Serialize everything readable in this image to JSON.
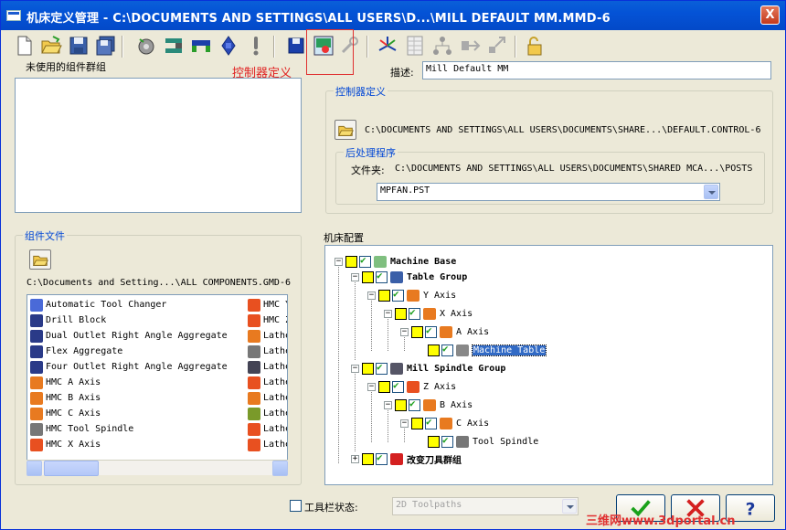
{
  "window": {
    "title": "机床定义管理 - C:\\DOCUMENTS AND SETTINGS\\ALL USERS\\D...\\MILL DEFAULT MM.MMD-6",
    "close_glyph": "X"
  },
  "toolbar": {
    "tooltip": "控制器定义",
    "icons": [
      "new-file-icon",
      "open-folder-icon",
      "save-icon",
      "save-as-icon",
      "tool-change-icon",
      "machine-component-icon",
      "clamp-icon",
      "spindle-icon",
      "warning-icon",
      "disk-icon",
      "control-definition-icon",
      "wrench-icon",
      "axis-icon",
      "grid-table-icon",
      "tree-structure-icon",
      "move-arrow-icon",
      "diagonal-arrow-icon",
      "lock-icon"
    ]
  },
  "unused_groups": {
    "label": "未使用的组件群组"
  },
  "description": {
    "label": "描述:",
    "value": "Mill Default MM"
  },
  "control_definition": {
    "title": "控制器定义",
    "path": "C:\\DOCUMENTS AND SETTINGS\\ALL USERS\\DOCUMENTS\\SHARE...\\DEFAULT.CONTROL-6"
  },
  "post_processor": {
    "title": "后处理程序",
    "folder_label": "文件夹:",
    "folder_path": "C:\\DOCUMENTS AND SETTINGS\\ALL USERS\\DOCUMENTS\\SHARED MCA...\\POSTS",
    "selected": "MPFAN.PST"
  },
  "component_files": {
    "title": "组件文件",
    "path": "C:\\Documents and Setting...\\ALL COMPONENTS.GMD-6",
    "left_items": [
      {
        "label": "Automatic Tool Changer",
        "icon": "tool-changer-icon"
      },
      {
        "label": "Drill Block",
        "icon": "drill-block-icon"
      },
      {
        "label": "Dual Outlet Right Angle Aggregate",
        "icon": "aggregate-icon"
      },
      {
        "label": "Flex Aggregate",
        "icon": "aggregate-icon"
      },
      {
        "label": "Four Outlet Right Angle Aggregate",
        "icon": "aggregate-icon"
      },
      {
        "label": "HMC A Axis",
        "icon": "axis-component-icon"
      },
      {
        "label": "HMC B Axis",
        "icon": "axis-component-icon"
      },
      {
        "label": "HMC C Axis",
        "icon": "axis-component-icon"
      },
      {
        "label": "HMC Tool Spindle",
        "icon": "spindle-icon"
      },
      {
        "label": "HMC X Axis",
        "icon": "linear-axis-icon"
      }
    ],
    "right_items": [
      {
        "label": "HMC Y",
        "icon": "linear-axis-icon"
      },
      {
        "label": "HMC Z",
        "icon": "linear-axis-icon"
      },
      {
        "label": "Lathe",
        "icon": "axis-component-icon"
      },
      {
        "label": "Lathe",
        "icon": "spindle-icon"
      },
      {
        "label": "Lathe",
        "icon": "turret-icon"
      },
      {
        "label": "Lathe",
        "icon": "linear-axis-icon"
      },
      {
        "label": "Lathe",
        "icon": "axis-component-icon"
      },
      {
        "label": "Lathe",
        "icon": "tailstock-icon"
      },
      {
        "label": "Lathe",
        "icon": "linear-axis-icon"
      },
      {
        "label": "Lathe",
        "icon": "linear-axis-icon"
      }
    ]
  },
  "machine_config": {
    "title": "机床配置",
    "nodes": [
      {
        "label": "Machine Base",
        "bold": true
      },
      {
        "label": "Table Group",
        "bold": true
      },
      {
        "label": "Y Axis",
        "bold": false
      },
      {
        "label": "X Axis",
        "bold": false
      },
      {
        "label": "A Axis",
        "bold": false
      },
      {
        "label": "Machine Table",
        "bold": false,
        "selected": true
      },
      {
        "label": "Mill Spindle Group",
        "bold": true
      },
      {
        "label": "Z Axis",
        "bold": false
      },
      {
        "label": "B Axis",
        "bold": false
      },
      {
        "label": "C Axis",
        "bold": false
      },
      {
        "label": "Tool Spindle",
        "bold": false
      },
      {
        "label": "改变刀具群组",
        "bold": true
      }
    ]
  },
  "toolbar_state": {
    "label": "工具栏状态:",
    "value": "2D Toolpaths",
    "checked": false
  },
  "buttons": {
    "ok_icon": "green-check-icon",
    "cancel_icon": "red-x-icon",
    "help_icon": "question-mark-icon"
  },
  "watermark": "三维网www.3dportal.cn",
  "colors": {
    "titlebar": "#0453d6",
    "group_title": "#0046d5",
    "selection": "#316ac5",
    "tooltip": "#e02020"
  }
}
